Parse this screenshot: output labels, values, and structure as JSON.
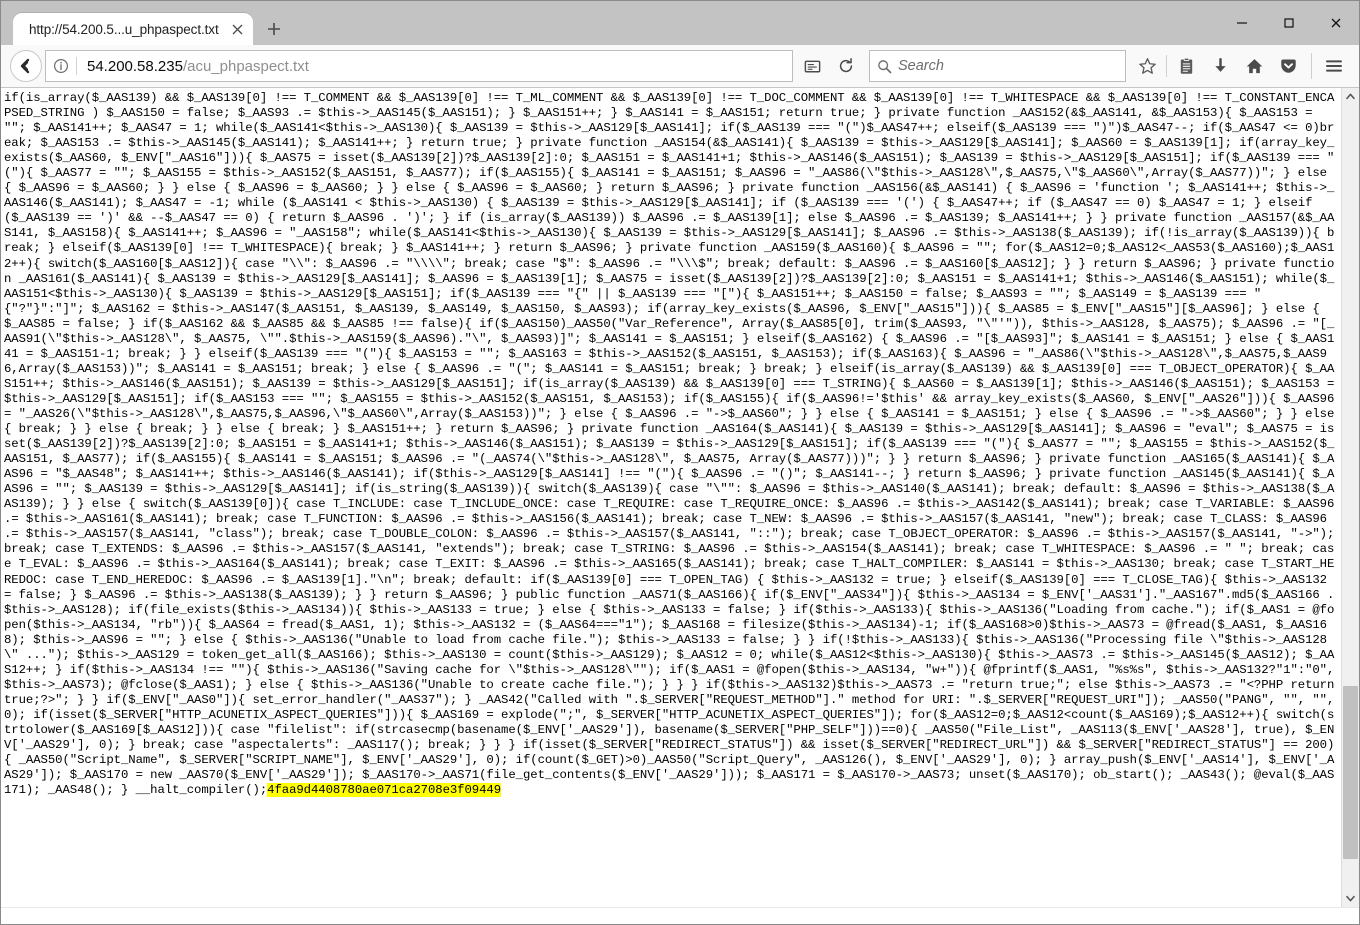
{
  "window": {
    "controls": {
      "minimize_label": "Minimize",
      "maximize_label": "Maximize",
      "close_label": "Close"
    }
  },
  "tabs": {
    "items": [
      {
        "title": "http://54.200.5...u_phpaspect.txt",
        "active": true,
        "close_label": "✕"
      }
    ],
    "new_tab_label": "+"
  },
  "navbar": {
    "back_label": "Back",
    "identity_icon": "info-icon",
    "url_display": "54.200.58.235",
    "url_path": "/acu_phpaspect.txt",
    "reader_label": "Reader View",
    "reload_label": "Reload",
    "search": {
      "placeholder": "Search",
      "value": ""
    },
    "buttons": [
      {
        "name": "bookmark-star-button",
        "label": "Bookmark this page"
      },
      {
        "name": "library-button",
        "label": "Library"
      },
      {
        "name": "downloads-button",
        "label": "Downloads"
      },
      {
        "name": "home-button",
        "label": "Home"
      },
      {
        "name": "pocket-button",
        "label": "Save to Pocket"
      },
      {
        "name": "menu-button",
        "label": "Open menu"
      }
    ]
  },
  "accent": {
    "highlight_bg": "#ffff00",
    "chrome_bg": "#c3c3c3",
    "nav_bg": "#f9f9f9",
    "text": "#000000"
  },
  "page": {
    "content_type": "text/plain",
    "highlighted_token": "4faa9d4408780ae071ca2708e3f09449",
    "body_before_highlight": "if(is_array($_AAS139) && $_AAS139[0] !== T_COMMENT && $_AAS139[0] !== T_ML_COMMENT && $_AAS139[0] !== T_DOC_COMMENT && $_AAS139[0] !== T_WHITESPACE && $_AAS139[0] !== T_CONSTANT_ENCAPSED_STRING ) $_AAS150 = false; $_AAS93 .= $this->_AAS145($_AAS151); } $_AAS151++; } $_AAS141 = $_AAS151; return true; } private function _AAS152(&$_AAS141, &$_AAS153){ $_AAS153 = \"\"; $_AAS141++; $_AAS47 = 1; while($_AAS141<$this->_AAS130){ $_AAS139 = $this->_AAS129[$_AAS141]; if($_AAS139 === \"(\")$_AAS47++; elseif($_AAS139 === \")\")$_AAS47--; if($_AAS47 <= 0)break; $_AAS153 .= $this->_AAS145($_AAS141); $_AAS141++; } return true; } private function _AAS154(&$_AAS141){ $_AAS139 = $this->_AAS129[$_AAS141]; $_AAS60 = $_AAS139[1]; if(array_key_exists($_AAS60, $_ENV[\"_AAS16\"])){ $_AAS75 = isset($_AAS139[2])?$_AAS139[2]:0; $_AAS151 = $_AAS141+1; $this->_AAS146($_AAS151); $_AAS139 = $this->_AAS129[$_AAS151]; if($_AAS139 === \"(\"){ $_AAS77 = \"\"; $_AAS155 = $this->_AAS152($_AAS151, $_AAS77); if($_AAS155){ $_AAS141 = $_AAS151; $_AAS96 = \"_AAS86(\\\"$this->_AAS128\\\",$_AAS75,\\\"$_AAS60\\\",Array($_AAS77))\"; } else { $_AAS96 = $_AAS60; } } else { $_AAS96 = $_AAS60; } } else { $_AAS96 = $_AAS60; } return $_AAS96; } private function _AAS156(&$_AAS141) { $_AAS96 = 'function '; $_AAS141++; $this->_AAS146($_AAS141); $_AAS47 = -1; while ($_AAS141 < $this->_AAS130) { $_AAS139 = $this->_AAS129[$_AAS141]; if ($_AAS139 === '(') { $_AAS47++; if ($_AAS47 == 0) $_AAS47 = 1; } elseif ($_AAS139 == ')' && --$_AAS47 == 0) { return $_AAS96 . ')'; } if (is_array($_AAS139)) $_AAS96 .= $_AAS139[1]; else $_AAS96 .= $_AAS139; $_AAS141++; } } private function _AAS157(&$_AAS141, $_AAS158){ $_AAS141++; $_AAS96 = \"_AAS158\"; while($_AAS141<$this->_AAS130){ $_AAS139 = $this->_AAS129[$_AAS141]; $_AAS96 .= $this->_AAS138($_AAS139); if(!is_array($_AAS139)){ break; } elseif($_AAS139[0] !== T_WHITESPACE){ break; } $_AAS141++; } return $_AAS96; } private function _AAS159($_AAS160){ $_AAS96 = \"\"; for($_AAS12=0;$_AAS12<_AAS53($_AAS160);$_AAS12++){ switch($_AAS160[$_AAS12]){ case \"\\\\\": $_AAS96 .= \"\\\\\\\\\"; break; case \"$\": $_AAS96 .= \"\\\\\\$\"; break; default: $_AAS96 .= $_AAS160[$_AAS12]; } } return $_AAS96; } private function _AAS161($_AAS141){ $_AAS139 = $this->_AAS129[$_AAS141]; $_AAS96 = $_AAS139[1]; $_AAS75 = isset($_AAS139[2])?$_AAS139[2]:0; $_AAS151 = $_AAS141+1; $this->_AAS146($_AAS151); while($_AAS151<$this->_AAS130){ $_AAS139 = $this->_AAS129[$_AAS151]; if($_AAS139 === \"{\" || $_AAS139 === \"[\"){ $_AAS151++; $_AAS150 = false; $_AAS93 = \"\"; $_AAS149 = $_AAS139 === \"{\"?\"}\":\"]\"; $_AAS162 = $this->_AAS147($_AAS151, $_AAS139, $_AAS149, $_AAS150, $_AAS93); if(array_key_exists($_AAS96, $_ENV[\"_AAS15\"])){ $_AAS85 = $_ENV[\"_AAS15\"][$_AAS96]; } else { $_AAS85 = false; } if($_AAS162 && $_AAS85 && $_AAS85 !== false){ if($_AAS150)_AAS50(\"Var_Reference\", Array($_AAS85[0], trim($_AAS93, \"\\\"'\")), $this->_AAS128, $_AAS75); $_AAS96 .= \"[_AAS91(\\\"$this->_AAS128\\\", $_AAS75, \\\"\".$this->_AAS159($_AAS96).\"\\\", $_AAS93)]\"; $_AAS141 = $_AAS151; } elseif($_AAS162) { $_AAS96 .= \"[$_AAS93]\"; $_AAS141 = $_AAS151; } else { $_AAS141 = $_AAS151-1; break; } } elseif($_AAS139 === \"(\"){ $_AAS153 = \"\"; $_AAS163 = $this->_AAS152($_AAS151, $_AAS153); if($_AAS163){ $_AAS96 = \"_AAS86(\\\"$this->_AAS128\\\",$_AAS75,$_AAS96,Array($_AAS153))\"; $_AAS141 = $_AAS151; break; } else { $_AAS96 .= \"(\"; $_AAS141 = $_AAS151; break; } break; } elseif(is_array($_AAS139) && $_AAS139[0] === T_OBJECT_OPERATOR){ $_AAS151++; $this->_AAS146($_AAS151); $_AAS139 = $this->_AAS129[$_AAS151]; if(is_array($_AAS139) && $_AAS139[0] === T_STRING){ $_AAS60 = $_AAS139[1]; $this->_AAS146($_AAS151); $_AAS153 = $this->_AAS129[$_AAS151]; if($_AAS153 === \"\"; $_AAS155 = $this->_AAS152($_AAS151, $_AAS153); if($_AAS155){ if($_AAS96!='$this' && array_key_exists($_AAS60, $_ENV[\"_AAS26\"])){ $_AAS96 = \"_AAS26(\\\"$this->_AAS128\\\",$_AAS75,$_AAS96,\\\"$_AAS60\\\",Array($_AAS153))\"; } else { $_AAS96 .= \"->$_AAS60\"; } } else { $_AAS141 = $_AAS151; } else { $_AAS96 .= \"->$_AAS60\"; } } else { break; } } else { break; } } else { break; } $_AAS151++; } return $_AAS96; } private function _AAS164($_AAS141){ $_AAS139 = $this->_AAS129[$_AAS141]; $_AAS96 = \"eval\"; $_AAS75 = isset($_AAS139[2])?$_AAS139[2]:0; $_AAS151 = $_AAS141+1; $this->_AAS146($_AAS151); $_AAS139 = $this->_AAS129[$_AAS151]; if($_AAS139 === \"(\"){ $_AAS77 = \"\"; $_AAS155 = $this->_AAS152($_AAS151, $_AAS77); if($_AAS155){ $_AAS141 = $_AAS151; $_AAS96 .= \"(_AAS74(\\\"$this->_AAS128\\\", $_AAS75, Array($_AAS77)))\"; } } return $_AAS96; } private function _AAS165($_AAS141){ $_AAS96 = \"$_AAS48\"; $_AAS141++; $this->_AAS146($_AAS141); if($this->_AAS129[$_AAS141] !== \"(\"){ $_AAS96 .= \"()\"; $_AAS141--; } return $_AAS96; } private function _AAS145($_AAS141){ $_AAS96 = \"\"; $_AAS139 = $this->_AAS129[$_AAS141]; if(is_string($_AAS139)){ switch($_AAS139){ case \"\\\"\": $_AAS96 = $this->_AAS140($_AAS141); break; default: $_AAS96 = $this->_AAS138($_AAS139); } } else { switch($_AAS139[0]){ case T_INCLUDE: case T_INCLUDE_ONCE: case T_REQUIRE: case T_REQUIRE_ONCE: $_AAS96 .= $this->_AAS142($_AAS141); break; case T_VARIABLE: $_AAS96 .= $this->_AAS161($_AAS141); break; case T_FUNCTION: $_AAS96 .= $this->_AAS156($_AAS141); break; case T_NEW: $_AAS96 .= $this->_AAS157($_AAS141, \"new\"); break; case T_CLASS: $_AAS96 .= $this->_AAS157($_AAS141, \"class\"); break; case T_DOUBLE_COLON: $_AAS96 .= $this->_AAS157($_AAS141, \"::\"); break; case T_OBJECT_OPERATOR: $_AAS96 .= $this->_AAS157($_AAS141, \"->\"); break; case T_EXTENDS: $_AAS96 .= $this->_AAS157($_AAS141, \"extends\"); break; case T_STRING: $_AAS96 .= $this->_AAS154($_AAS141); break; case T_WHITESPACE: $_AAS96 .= \" \"; break; case T_EVAL: $_AAS96 .= $this->_AAS164($_AAS141); break; case T_EXIT: $_AAS96 .= $this->_AAS165($_AAS141); break; case T_HALT_COMPILER: $_AAS141 = $this->_AAS130; break; case T_START_HEREDOC: case T_END_HEREDOC: $_AAS96 .= $_AAS139[1].\"\\n\"; break; default: if($_AAS139[0] === T_OPEN_TAG) { $this->_AAS132 = true; } elseif($_AAS139[0] === T_CLOSE_TAG){ $this->_AAS132 = false; } $_AAS96 .= $this->_AAS138($_AAS139); } } return $_AAS96; } public function _AAS71($_AAS166){ if($_ENV[\"_AAS34\"]){ $this->_AAS134 = $_ENV['_AAS31'].\"_AAS167\".md5($_AAS166 . $this->_AAS128); if(file_exists($this->_AAS134)){ $this->_AAS133 = true; } else { $this->_AAS133 = false; } if($this->_AAS133){ $this->_AAS136(\"Loading from cache.\"); if($_AAS1 = @fopen($this->_AAS134, \"rb\")){ $_AAS64 = fread($_AAS1, 1); $this->_AAS132 = ($_AAS64===\"1\"); $_AAS168 = filesize($this->_AAS134)-1; if($_AAS168>0)$this->_AAS73 = @fread($_AAS1, $_AAS168); $this->_AAS96 = \"\"; } else { $this->_AAS136(\"Unable to load from cache file.\"); $this->_AAS133 = false; } } if(!$this->_AAS133){ $this->_AAS136(\"Processing file \\\"$this->_AAS128\\\" ...\"); $this->_AAS129 = token_get_all($_AAS166); $this->_AAS130 = count($this->_AAS129); $_AAS12 = 0; while($_AAS12<$this->_AAS130){ $this->_AAS73 .= $this->_AAS145($_AAS12); $_AAS12++; } if($this->_AAS134 !== \"\"){ $this->_AAS136(\"Saving cache for \\\"$this->_AAS128\\\"\"); if($_AAS1 = @fopen($this->_AAS134, \"w+\")){ @fprintf($_AAS1, \"%s%s\", $this->_AAS132?\"1\":\"0\", $this->_AAS73); @fclose($_AAS1); } else { $this->_AAS136(\"Unable to create cache file.\"); } } } if($this->_AAS132)$this->_AAS73 .= \"return true;\"; else $this->_AAS73 .= \"<?PHP return true;?>\"; } } if($_ENV[\"_AAS0\"]){ set_error_handler(\"_AAS37\"); } _AAS42(\"Called with \".$_SERVER[\"REQUEST_METHOD\"].\" method for URI: \".$_SERVER[\"REQUEST_URI\"]); _AAS50(\"PANG\", \"\", \"\", 0); if(isset($_SERVER[\"HTTP_ACUNETIX_ASPECT_QUERIES\"])){ $_AAS169 = explode(\";\", $_SERVER[\"HTTP_ACUNETIX_ASPECT_QUERIES\"]); for($_AAS12=0;$_AAS12<count($_AAS169);$_AAS12++){ switch(strtolower($_AAS169[$_AAS12])){ case \"filelist\": if(strcasecmp(basename($_ENV['_AAS29']), basename($_SERVER[\"PHP_SELF\"]))==0){ _AAS50(\"File_List\", _AAS113($_ENV['_AAS28'], true), $_ENV['_AAS29'], 0); } break; case \"aspectalerts\": _AAS117(); break; } } } if(isset($_SERVER[\"REDIRECT_STATUS\"]) && isset($_SERVER[\"REDIRECT_URL\"]) && $_SERVER[\"REDIRECT_STATUS\"] == 200){ _AAS50(\"Script_Name\", $_SERVER[\"SCRIPT_NAME\"], $_ENV['_AAS29'], 0); if(count($_GET)>0)_AAS50(\"Script_Query\", _AAS126(), $_ENV['_AAS29'], 0); } array_push($_ENV['_AAS14'], $_ENV['_AAS29']); $_AAS170 = new _AAS70($_ENV['_AAS29']); $_AAS170->_AAS71(file_get_contents($_ENV['_AAS29'])); $_AAS171 = $_AAS170->_AAS73; unset($_AAS170); ob_start(); _AAS43(); @eval($_AAS171); _AAS48(); } __halt_compiler();"
  }
}
